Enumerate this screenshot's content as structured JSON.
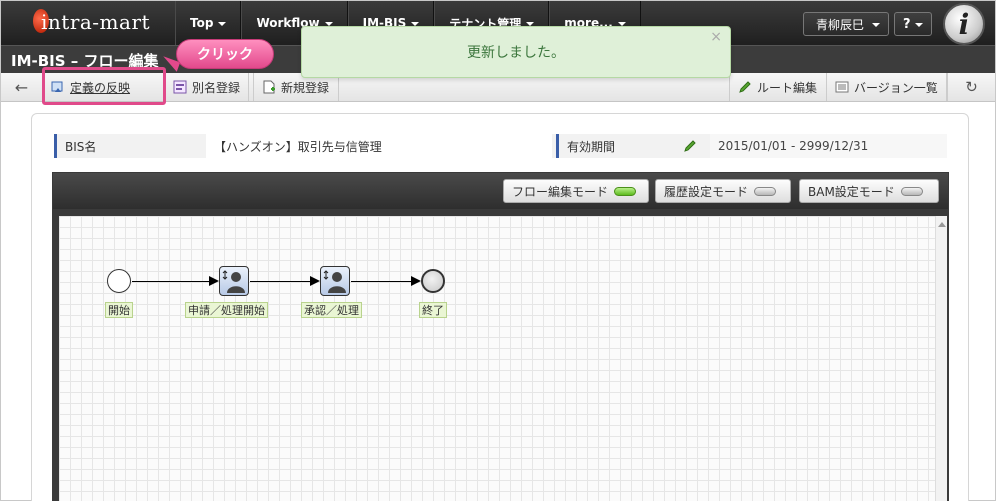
{
  "app": {
    "logo_text": "intra-mart",
    "logo_letter": "i"
  },
  "nav": {
    "items": [
      {
        "label": "Top"
      },
      {
        "label": "Workflow"
      },
      {
        "label": "IM-BIS"
      },
      {
        "label": "テナント管理"
      },
      {
        "label": "more..."
      }
    ],
    "user_name": "青柳辰巳",
    "help_label": "?"
  },
  "page": {
    "title": "IM-BIS – フロー編集"
  },
  "toolbar": {
    "back_icon": "←",
    "apply_label": "定義の反映",
    "alias_label": "別名登録",
    "new_label": "新規登録",
    "route_label": "ルート編集",
    "versions_label": "バージョン一覧",
    "refresh_icon": "↻"
  },
  "callout": {
    "label": "クリック",
    "color": "#e2498c"
  },
  "toast": {
    "message": "更新しました。",
    "close": "×"
  },
  "info": {
    "bis_name_label": "BIS名",
    "bis_name_value": "【ハンズオン】取引先与信管理",
    "period_label": "有効期間",
    "period_value": "2015/01/01 - 2999/12/31"
  },
  "modes": {
    "flow": {
      "label": "フロー編集モード",
      "active": true
    },
    "history": {
      "label": "履歴設定モード",
      "active": false
    },
    "bam": {
      "label": "BAM設定モード",
      "active": false
    }
  },
  "flow": {
    "start_label": "開始",
    "apply_task_label": "申請／処理開始",
    "approve_task_label": "承認／処理",
    "end_label": "終了"
  }
}
